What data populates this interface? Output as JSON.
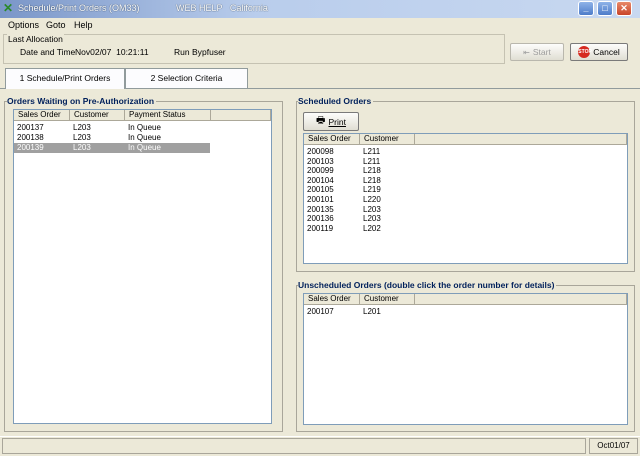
{
  "window": {
    "title": "Schedule/Print Orders (OM33)",
    "subtitle": "WEB HELP   California",
    "icon": "x-app-icon"
  },
  "menu": [
    "Options",
    "Goto",
    "Help"
  ],
  "last_allocation": {
    "legend": "Last Allocation",
    "date_time_label": "Date and Time",
    "date_time_value": "Nov02/07  10:21:11",
    "run_by_label": "Run By",
    "run_by_value": "pfuser"
  },
  "buttons": {
    "start": "Start",
    "cancel": "Cancel",
    "print": "Print"
  },
  "tabs": [
    {
      "label": "1 Schedule/Print Orders",
      "active": true
    },
    {
      "label": "2 Selection Criteria",
      "active": false
    }
  ],
  "waiting": {
    "legend": "Orders Waiting on Pre-Authorization",
    "columns": [
      "Sales Order",
      "Customer",
      "Payment Status"
    ],
    "rows": [
      {
        "order": "200137",
        "customer": "L203",
        "status": "In Queue",
        "selected": false
      },
      {
        "order": "200138",
        "customer": "L203",
        "status": "In Queue",
        "selected": false
      },
      {
        "order": "200139",
        "customer": "L203",
        "status": "In Queue",
        "selected": true
      }
    ]
  },
  "scheduled": {
    "legend": "Scheduled Orders",
    "columns": [
      "Sales Order",
      "Customer"
    ],
    "rows": [
      {
        "order": "200098",
        "customer": "L211"
      },
      {
        "order": "200103",
        "customer": "L211"
      },
      {
        "order": "200099",
        "customer": "L218"
      },
      {
        "order": "200104",
        "customer": "L218"
      },
      {
        "order": "200105",
        "customer": "L219"
      },
      {
        "order": "200101",
        "customer": "L220"
      },
      {
        "order": "200135",
        "customer": "L203"
      },
      {
        "order": "200136",
        "customer": "L203"
      },
      {
        "order": "200119",
        "customer": "L202"
      }
    ]
  },
  "unscheduled": {
    "legend": "Unscheduled Orders (double click the order number for details)",
    "columns": [
      "Sales Order",
      "Customer"
    ],
    "rows": [
      {
        "order": "200107",
        "customer": "L201"
      }
    ]
  },
  "status": {
    "date": "Oct01/07"
  }
}
